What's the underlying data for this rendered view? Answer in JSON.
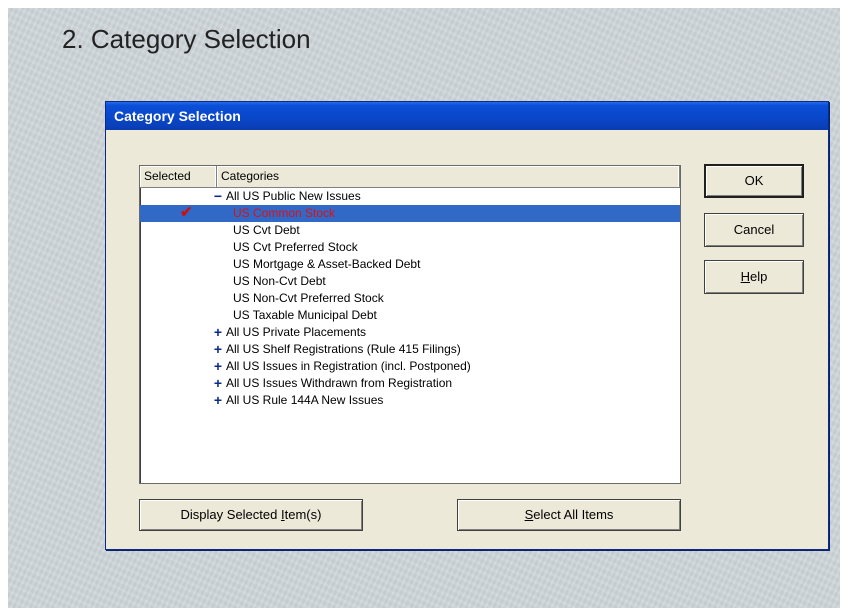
{
  "slide": {
    "title": "2. Category Selection"
  },
  "dialog": {
    "title": "Category Selection",
    "columns": {
      "selected": "Selected",
      "categories": "Categories"
    },
    "check_mark": "✔",
    "items": [
      {
        "label": "All US Public New Issues",
        "level": 0,
        "expander": "−"
      },
      {
        "label": "US Common Stock",
        "level": 1,
        "selected": true,
        "checked": true
      },
      {
        "label": "US Cvt Debt",
        "level": 1
      },
      {
        "label": "US Cvt Preferred Stock",
        "level": 1
      },
      {
        "label": "US Mortgage & Asset-Backed Debt",
        "level": 1
      },
      {
        "label": "US Non-Cvt Debt",
        "level": 1
      },
      {
        "label": "US Non-Cvt Preferred Stock",
        "level": 1
      },
      {
        "label": "US Taxable Municipal Debt",
        "level": 1
      },
      {
        "label": "All US Private Placements",
        "level": 0,
        "expander": "+"
      },
      {
        "label": "All US Shelf Registrations (Rule 415 Filings)",
        "level": 0,
        "expander": "+"
      },
      {
        "label": "All US Issues in Registration (incl. Postponed)",
        "level": 0,
        "expander": "+"
      },
      {
        "label": "All US Issues Withdrawn from Registration",
        "level": 0,
        "expander": "+"
      },
      {
        "label": "All US Rule 144A New Issues",
        "level": 0,
        "expander": "+"
      }
    ],
    "buttons": {
      "ok": "OK",
      "cancel": "Cancel",
      "help_mnemonic": "H",
      "help_rest": "elp",
      "display_pre": "Display Selected ",
      "display_mnemonic": "I",
      "display_post": "tem(s)",
      "select_mnemonic": "S",
      "select_rest": "elect All Items"
    },
    "colors": {
      "titlebar": "#0a46c8",
      "selection": "#3169c6",
      "checked_text": "#e01010"
    }
  }
}
